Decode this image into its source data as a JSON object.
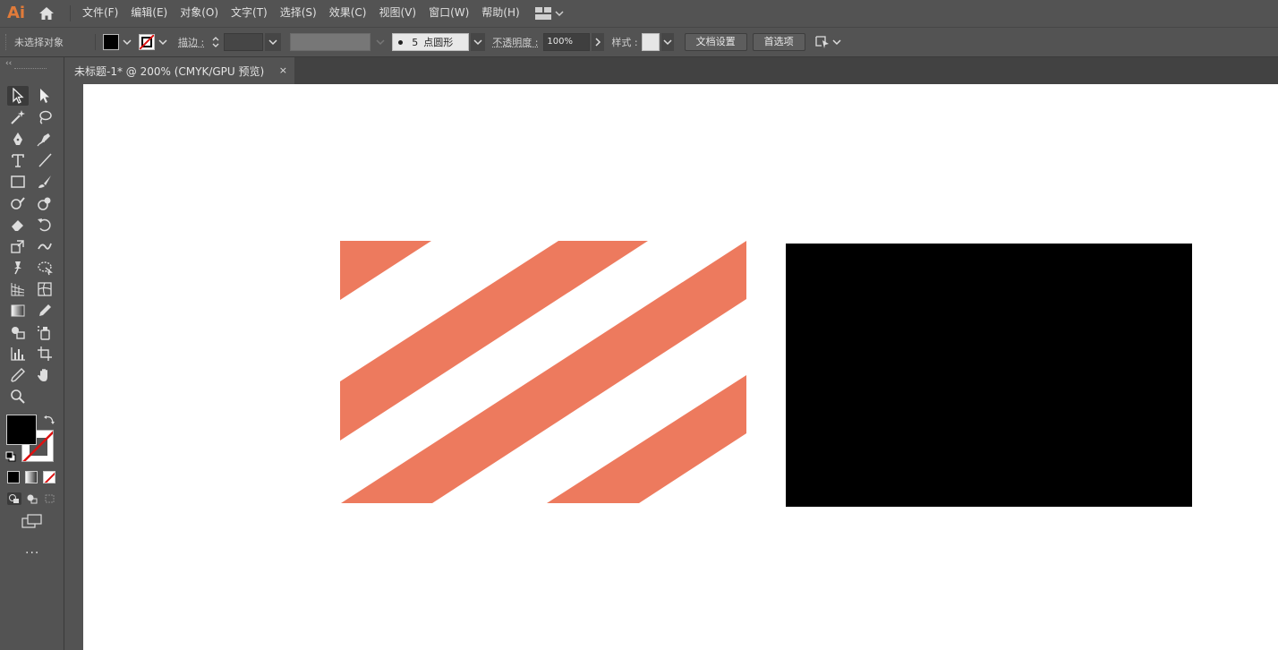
{
  "app": {
    "logo": "Ai"
  },
  "menu": {
    "items": [
      "文件(F)",
      "编辑(E)",
      "对象(O)",
      "文字(T)",
      "选择(S)",
      "效果(C)",
      "视图(V)",
      "窗口(W)",
      "帮助(H)"
    ]
  },
  "control": {
    "selection_status": "未选择对象",
    "stroke_label": "描边 :",
    "brush_size": "5",
    "brush_shape": "点圆形",
    "opacity_label": "不透明度 :",
    "opacity_value": "100%",
    "style_label": "样式 :",
    "doc_setup": "文档设置",
    "preferences": "首选项"
  },
  "tab": {
    "title": "未标题-1* @ 200% (CMYK/GPU 预览)",
    "close": "×"
  },
  "colors": {
    "stripe": "#ED7A5E",
    "rect": "#000000",
    "accent_logo": "#E07B3A"
  },
  "toolbar": {
    "more": "..."
  }
}
